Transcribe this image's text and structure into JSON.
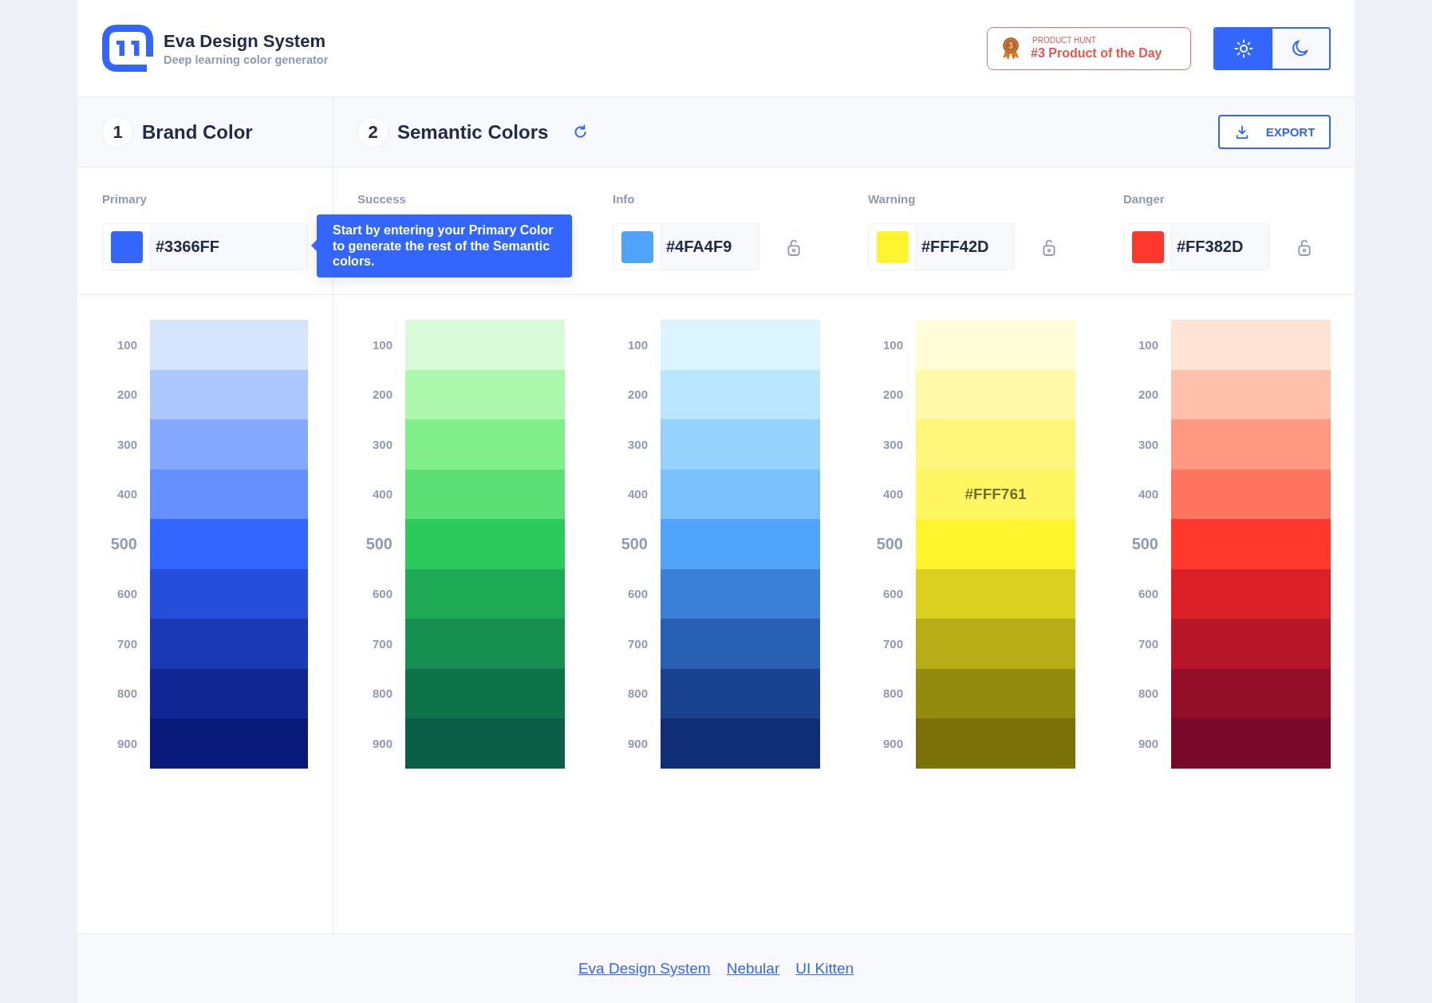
{
  "header": {
    "title": "Eva Design System",
    "subtitle": "Deep learning color generator",
    "badge": {
      "rank": "3",
      "eyebrow": "PRODUCT HUNT",
      "text": "#3 Product of the Day"
    },
    "theme_toggle": [
      {
        "kind": "light",
        "selected": true
      },
      {
        "kind": "dark",
        "selected": false
      }
    ]
  },
  "brand": {
    "step": "1",
    "title": "Brand Color",
    "palette": {
      "label": "Primary",
      "hex": "#3366FF",
      "color": "#3366ff",
      "swatches": [
        {
          "label": "100",
          "color": "#d6e4ff",
          "base": false
        },
        {
          "label": "200",
          "color": "#adc8ff",
          "base": false
        },
        {
          "label": "300",
          "color": "#84a9ff",
          "base": false
        },
        {
          "label": "400",
          "color": "#6690ff",
          "base": false
        },
        {
          "label": "500",
          "color": "#3366ff",
          "base": true
        },
        {
          "label": "600",
          "color": "#254edb",
          "base": false
        },
        {
          "label": "700",
          "color": "#1939b7",
          "base": false
        },
        {
          "label": "800",
          "color": "#102693",
          "base": false
        },
        {
          "label": "900",
          "color": "#091a7a",
          "base": false
        }
      ]
    }
  },
  "semantic": {
    "step": "2",
    "title": "Semantic Colors",
    "export_button": "EXPORT",
    "tooltip": "Start by entering your Primary Color to generate the rest of the Semantic colors.",
    "palettes": [
      {
        "label": "Success",
        "swatches": [
          {
            "label": "100",
            "color": "#d8fad6",
            "base": false
          },
          {
            "label": "200",
            "color": "#acf8ad",
            "base": false
          },
          {
            "label": "300",
            "color": "#80ef8b",
            "base": false
          },
          {
            "label": "400",
            "color": "#5ddf78",
            "base": false
          },
          {
            "label": "500",
            "color": "#2cc95d",
            "base": true
          },
          {
            "label": "600",
            "color": "#1fab56",
            "base": false
          },
          {
            "label": "700",
            "color": "#168f50",
            "base": false
          },
          {
            "label": "800",
            "color": "#0e734a",
            "base": false
          },
          {
            "label": "900",
            "color": "#0a5f46",
            "base": false
          }
        ]
      },
      {
        "label": "Info",
        "hex": "#4FA4F9",
        "color": "#4fa4f9",
        "locked": false,
        "swatches": [
          {
            "label": "100",
            "color": "#dcf4fe",
            "base": false
          },
          {
            "label": "200",
            "color": "#b9e6fe",
            "base": false
          },
          {
            "label": "300",
            "color": "#95d3fd",
            "base": false
          },
          {
            "label": "400",
            "color": "#7ac1fb",
            "base": false
          },
          {
            "label": "500",
            "color": "#4fa4f9",
            "base": true
          },
          {
            "label": "600",
            "color": "#3980d6",
            "base": false
          },
          {
            "label": "700",
            "color": "#275fb3",
            "base": false
          },
          {
            "label": "800",
            "color": "#194390",
            "base": false
          },
          {
            "label": "900",
            "color": "#0f2e77",
            "base": false
          }
        ]
      },
      {
        "label": "Warning",
        "hex": "#FFF42D",
        "color": "#fff42d",
        "locked": false,
        "swatches": [
          {
            "label": "100",
            "color": "#fffcd6",
            "base": false
          },
          {
            "label": "200",
            "color": "#fffaa8",
            "base": false
          },
          {
            "label": "300",
            "color": "#fff77c",
            "base": false
          },
          {
            "label": "400",
            "color": "#fff761",
            "base": false,
            "hex": "#FFF761"
          },
          {
            "label": "500",
            "color": "#fff42d",
            "base": true
          },
          {
            "label": "600",
            "color": "#dbd01f",
            "base": false
          },
          {
            "label": "700",
            "color": "#b7ad16",
            "base": false
          },
          {
            "label": "800",
            "color": "#938b0e",
            "base": false
          },
          {
            "label": "900",
            "color": "#7a7208",
            "base": false
          }
        ]
      },
      {
        "label": "Danger",
        "hex": "#FF382D",
        "color": "#ff382d",
        "locked": false,
        "swatches": [
          {
            "label": "100",
            "color": "#ffe3d5",
            "base": false
          },
          {
            "label": "200",
            "color": "#ffc0ab",
            "base": false
          },
          {
            "label": "300",
            "color": "#ff9881",
            "base": false
          },
          {
            "label": "400",
            "color": "#ff7361",
            "base": false
          },
          {
            "label": "500",
            "color": "#ff382d",
            "base": true
          },
          {
            "label": "600",
            "color": "#db2027",
            "base": false
          },
          {
            "label": "700",
            "color": "#b71629",
            "base": false
          },
          {
            "label": "800",
            "color": "#930e28",
            "base": false
          },
          {
            "label": "900",
            "color": "#7a082a",
            "base": false
          }
        ]
      }
    ]
  },
  "footer_links": [
    "Eva Design System",
    "Nebular",
    "UI Kitten"
  ]
}
